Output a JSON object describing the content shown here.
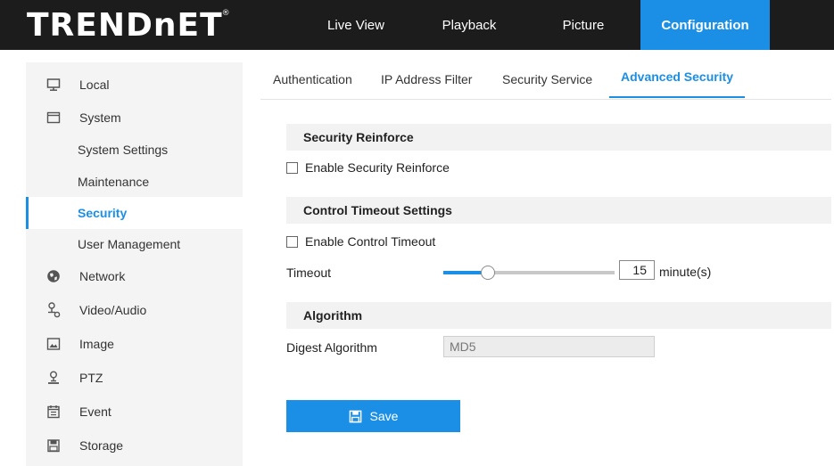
{
  "brand": {
    "logo_text": "TRENDnET",
    "reg_mark": "®"
  },
  "nav": {
    "live_view": "Live View",
    "playback": "Playback",
    "picture": "Picture",
    "configuration": "Configuration"
  },
  "sidebar": {
    "items": [
      {
        "label": "Local",
        "icon": "monitor-icon"
      },
      {
        "label": "System",
        "icon": "system-icon"
      },
      {
        "label": "System Settings"
      },
      {
        "label": "Maintenance"
      },
      {
        "label": "Security",
        "active": true
      },
      {
        "label": "User Management"
      },
      {
        "label": "Network",
        "icon": "network-icon"
      },
      {
        "label": "Video/Audio",
        "icon": "video-audio-icon"
      },
      {
        "label": "Image",
        "icon": "image-icon"
      },
      {
        "label": "PTZ",
        "icon": "ptz-icon"
      },
      {
        "label": "Event",
        "icon": "event-icon"
      },
      {
        "label": "Storage",
        "icon": "storage-icon"
      }
    ]
  },
  "tabs": {
    "authentication": "Authentication",
    "ip_filter": "IP Address Filter",
    "security_service": "Security Service",
    "advanced_security": "Advanced Security"
  },
  "security_reinforce": {
    "heading": "Security Reinforce",
    "enable_label": "Enable Security Reinforce",
    "checked": false
  },
  "control_timeout": {
    "heading": "Control Timeout Settings",
    "enable_label": "Enable Control Timeout",
    "checked": false,
    "timeout_label": "Timeout",
    "timeout_value": "15",
    "slider_fraction": 0.26,
    "unit": "minute(s)"
  },
  "algorithm": {
    "heading": "Algorithm",
    "digest_label": "Digest Algorithm",
    "digest_value": "MD5"
  },
  "save": {
    "label": "Save"
  },
  "colors": {
    "accent": "#1b8fe6",
    "topbar": "#1c1c1c",
    "sidebar_bg": "#f4f4f4"
  }
}
